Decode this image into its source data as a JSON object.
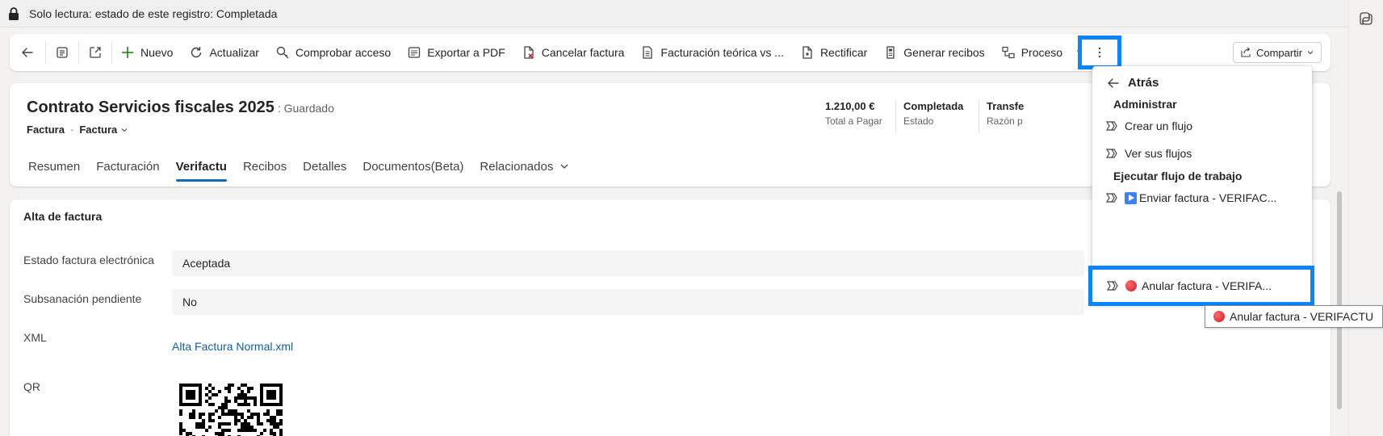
{
  "readonly_bar": {
    "text": "Solo lectura: estado de este registro: Completada"
  },
  "commands": {
    "nuevo": "Nuevo",
    "actualizar": "Actualizar",
    "comprobar": "Comprobar acceso",
    "exportar": "Exportar a PDF",
    "cancelar": "Cancelar factura",
    "facturacion": "Facturación teórica vs ...",
    "rectificar": "Rectificar",
    "generar": "Generar recibos",
    "proceso": "Proceso",
    "compartir": "Compartir"
  },
  "record": {
    "title": "Contrato Servicios fiscales 2025",
    "saved": ": Guardado",
    "entity": "Factura",
    "form": "Factura"
  },
  "header_fields": [
    {
      "value": "1.210,00 €",
      "label": "Total a Pagar"
    },
    {
      "value": "Completada",
      "label": "Estado"
    },
    {
      "value": "Transfe",
      "label": "Razón p"
    }
  ],
  "tabs": [
    "Resumen",
    "Facturación",
    "Verifactu",
    "Recibos",
    "Detalles",
    "Documentos(Beta)",
    "Relacionados"
  ],
  "section": {
    "title": "Alta de factura",
    "fields": {
      "estado_label": "Estado factura electrónica",
      "estado_value": "Aceptada",
      "subsanacion_label": "Subsanación pendiente",
      "subsanacion_value": "No",
      "xml_label": "XML",
      "xml_link": "Alta Factura Normal.xml",
      "qr_label": "QR"
    }
  },
  "menu": {
    "back": "Atrás",
    "admin_header": "Administrar",
    "crear_flujo": "Crear un flujo",
    "ver_flujos": "Ver sus flujos",
    "ejecutar_header": "Ejecutar flujo de trabajo",
    "enviar": "Enviar factura - VERIFAC...",
    "anular": "Anular factura - VERIFA..."
  },
  "tooltip": {
    "text": "Anular factura - VERIFACTU"
  },
  "colors": {
    "highlight": "#0a84ff",
    "link": "#115ea3",
    "tab_accent": "#0f6cbd"
  }
}
